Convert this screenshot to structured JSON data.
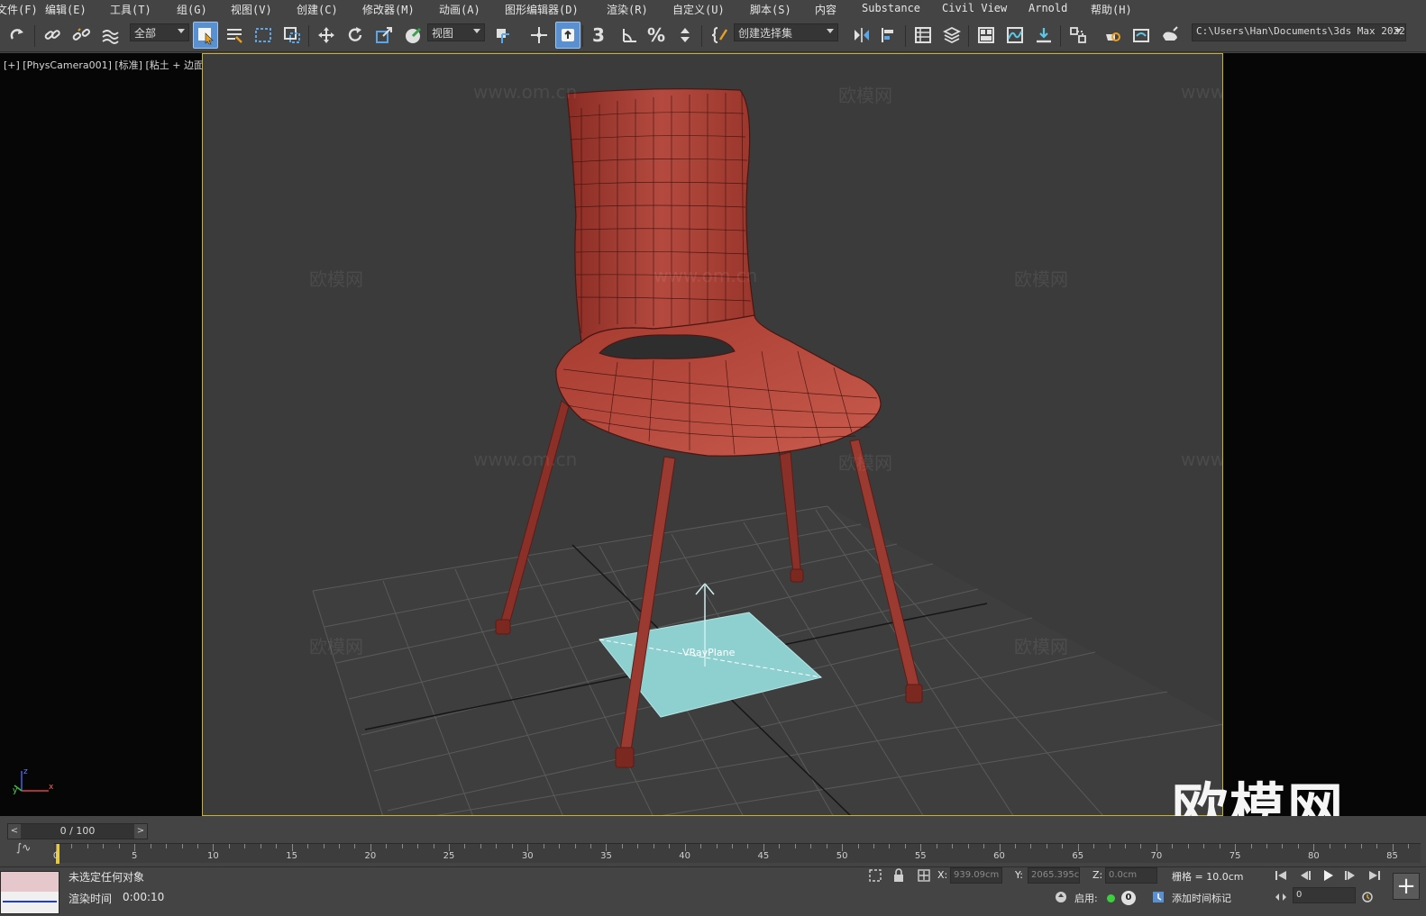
{
  "menu": [
    "文件(F)",
    "编辑(E)",
    "工具(T)",
    "组(G)",
    "视图(V)",
    "创建(C)",
    "修改器(M)",
    "动画(A)",
    "图形编辑器(D)",
    "渲染(R)",
    "自定义(U)",
    "脚本(S)",
    "内容",
    "Substance",
    "Civil View",
    "Arnold",
    "帮助(H)"
  ],
  "toolbar": {
    "selection_filter": "全部",
    "ref_coord": "视图",
    "named_selection_placeholder": "创建选择集",
    "project_path": "C:\\Users\\Han\\Documents\\3ds Max 2022",
    "snap_label": "3"
  },
  "viewport": {
    "label": "[+] [PhysCamera001] [标准] [粘土 + 边面]",
    "object_label": "VRayPlane",
    "gizmo_axes": [
      "z",
      "y",
      "x"
    ],
    "watermarks": [
      "欧模网",
      "www.om.cn"
    ],
    "logo": "欧模网",
    "colors": {
      "chair": "#b5463b",
      "plane": "#8ecfd0",
      "frame": "#c9b137"
    }
  },
  "timeline": {
    "slider_text": "0 / 100",
    "ticks": [
      "0",
      "5",
      "10",
      "15",
      "20",
      "25",
      "30",
      "35",
      "40",
      "45",
      "50",
      "55",
      "60",
      "65",
      "70",
      "75",
      "80",
      "85"
    ]
  },
  "status": {
    "selection": "未选定任何对象",
    "render_time_label": "渲染时间",
    "render_time": "0:00:10",
    "x_label": "X:",
    "x_value": "939.09cm",
    "y_label": "Y:",
    "y_value": "2065.395c",
    "z_label": "Z:",
    "z_value": "0.0cm",
    "grid": "栅格 = 10.0cm",
    "enable_label": "启用:",
    "enable_count": "0",
    "add_time_tag": "添加时间标记",
    "frame_value": "0"
  }
}
